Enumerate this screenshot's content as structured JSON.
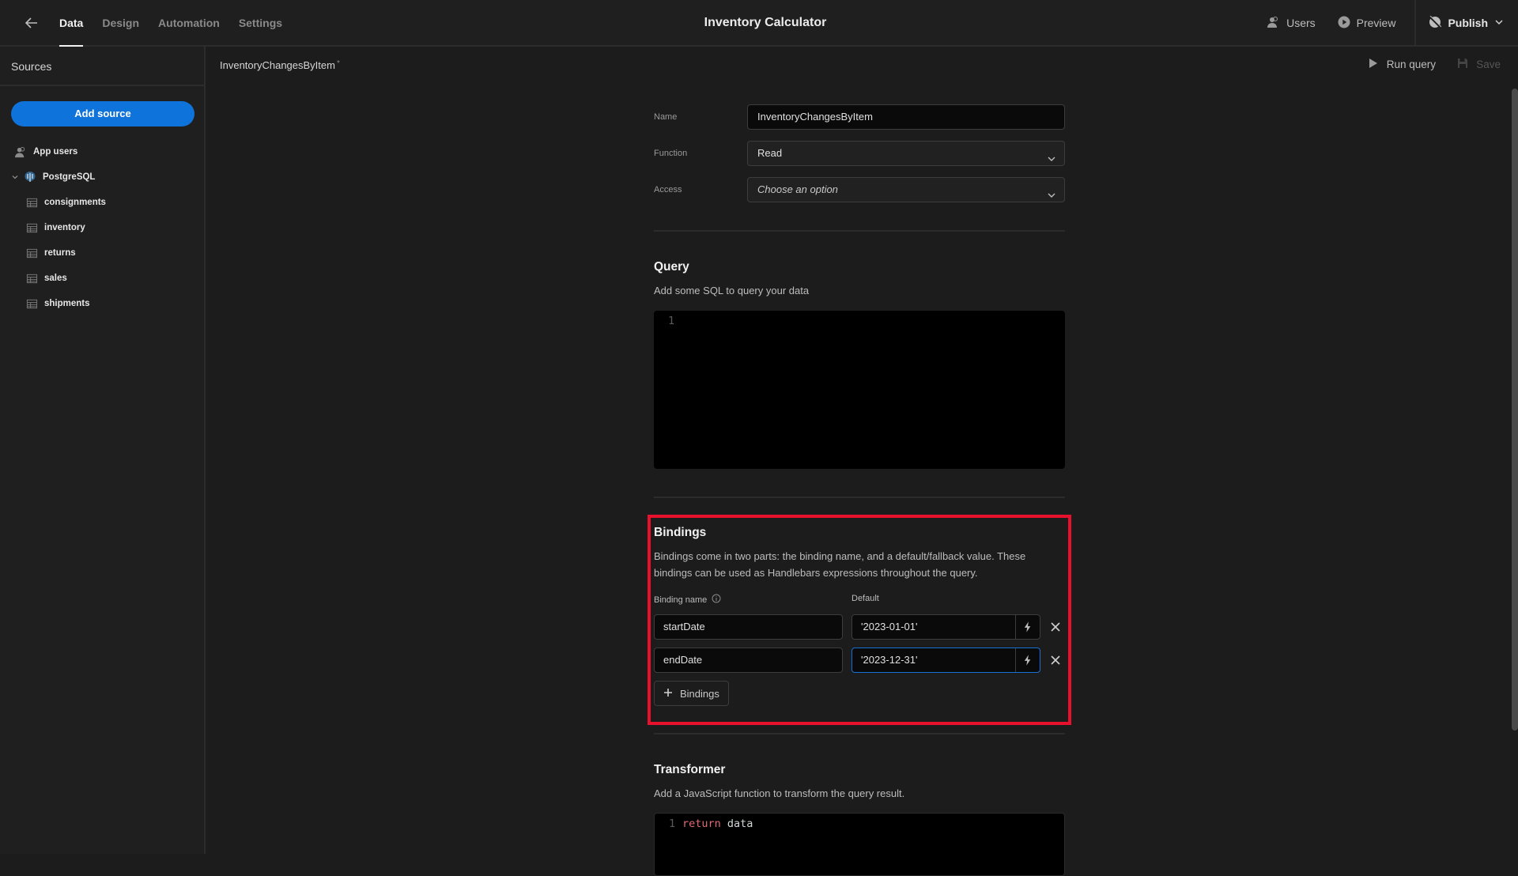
{
  "topbar": {
    "tabs": [
      {
        "label": "Data",
        "active": true
      },
      {
        "label": "Design",
        "active": false
      },
      {
        "label": "Automation",
        "active": false
      },
      {
        "label": "Settings",
        "active": false
      }
    ],
    "title": "Inventory Calculator",
    "users_label": "Users",
    "preview_label": "Preview",
    "publish_label": "Publish"
  },
  "sidebar": {
    "heading": "Sources",
    "add_source_label": "Add source",
    "items": [
      {
        "label": "App users",
        "icon": "users-icon"
      },
      {
        "label": "PostgreSQL",
        "icon": "postgresql-icon",
        "expanded": true
      },
      {
        "label": "consignments",
        "icon": "table-icon"
      },
      {
        "label": "inventory",
        "icon": "table-icon"
      },
      {
        "label": "returns",
        "icon": "table-icon"
      },
      {
        "label": "sales",
        "icon": "table-icon"
      },
      {
        "label": "shipments",
        "icon": "table-icon"
      }
    ]
  },
  "query": {
    "title": "InventoryChangesByItem",
    "unsaved_marker": "*",
    "run_label": "Run query",
    "save_label": "Save",
    "name_label": "Name",
    "name_value": "InventoryChangesByItem",
    "function_label": "Function",
    "function_value": "Read",
    "access_label": "Access",
    "access_placeholder": "Choose an option",
    "query_heading": "Query",
    "query_sub": "Add some SQL to query your data",
    "query_line_number": "1",
    "query_code": ""
  },
  "bindings": {
    "heading": "Bindings",
    "description": "Bindings come in two parts: the binding name, and a default/fallback value. These bindings can be used as Handlebars expressions throughout the query.",
    "name_col_label": "Binding name",
    "default_col_label": "Default",
    "rows": [
      {
        "name": "startDate",
        "default": "'2023-01-01'"
      },
      {
        "name": "endDate",
        "default": "'2023-12-31'"
      }
    ],
    "add_label": "Bindings",
    "highlight_color": "#e8112d"
  },
  "transformer": {
    "heading": "Transformer",
    "sub": "Add a JavaScript function to transform the query result.",
    "line_number": "1",
    "keyword": "return",
    "identifier": "data"
  },
  "colors": {
    "accent": "#0f73dc",
    "background": "#1c1c1c",
    "keyword": "#e06c75"
  }
}
